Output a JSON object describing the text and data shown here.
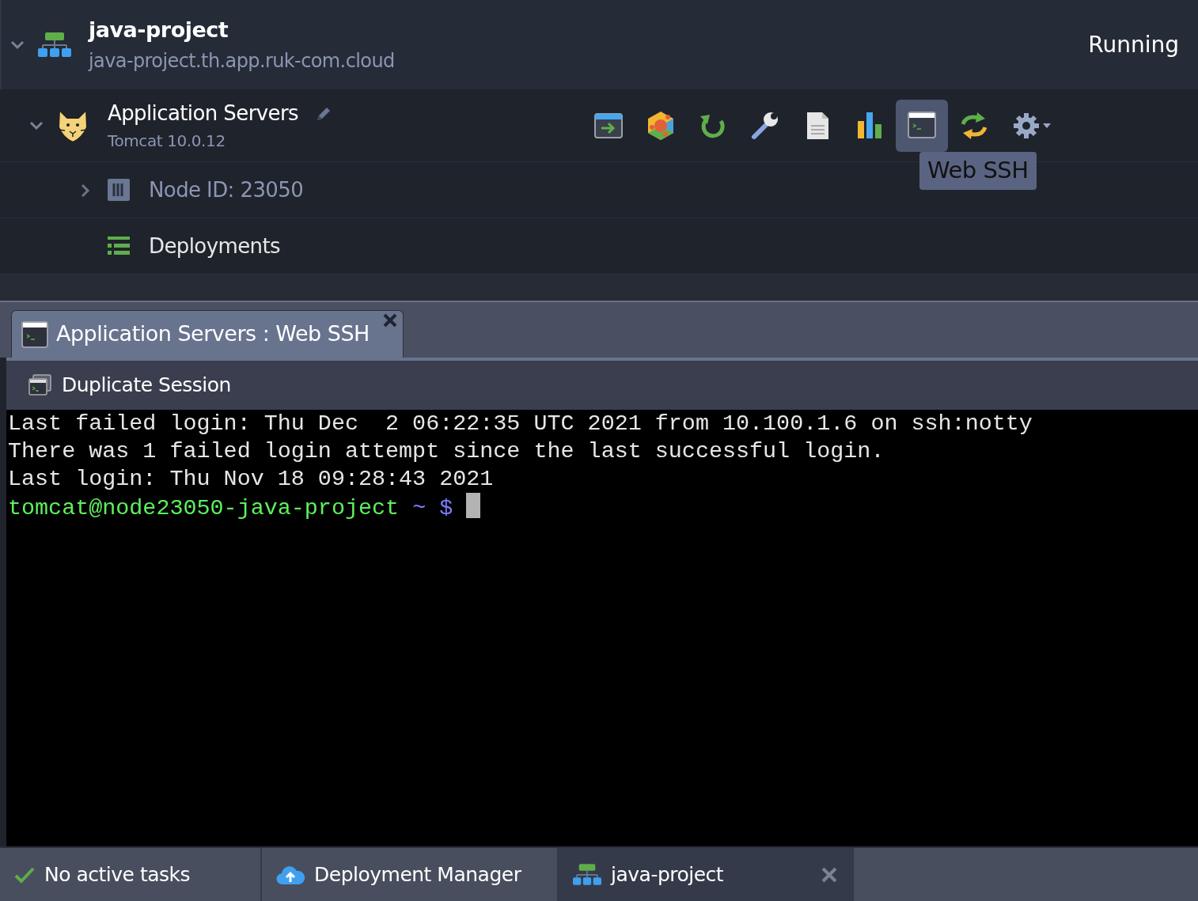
{
  "environment": {
    "name": "java-project",
    "domain": "java-project.th.app.ruk-com.cloud",
    "status": "Running",
    "expanded": true
  },
  "node_group": {
    "name": "Application Servers",
    "version": "Tomcat 10.0.12",
    "expanded": true,
    "toolbar": [
      {
        "kind": "open",
        "selected": false
      },
      {
        "kind": "addons",
        "selected": false
      },
      {
        "kind": "restart",
        "selected": false
      },
      {
        "kind": "config",
        "selected": false
      },
      {
        "kind": "log",
        "selected": false
      },
      {
        "kind": "stats",
        "selected": false
      },
      {
        "kind": "ssh",
        "selected": true
      },
      {
        "kind": "redeploy",
        "selected": false
      },
      {
        "kind": "settings",
        "selected": false
      }
    ],
    "tooltip": "Web SSH",
    "children": [
      {
        "kind": "node",
        "label": "Node ID: 23050",
        "expanded": false
      },
      {
        "kind": "deployments",
        "label": "Deployments"
      }
    ]
  },
  "session_tabs": [
    {
      "label": "Application Servers : Web SSH",
      "selected": true
    }
  ],
  "session_toolbar": {
    "action": "Duplicate Session"
  },
  "terminal": {
    "lines": [
      "Last failed login: Thu Dec  2 06:22:35 UTC 2021 from 10.100.1.6 on ssh:notty",
      "There was 1 failed login attempt since the last successful login.",
      "Last login: Thu Nov 18 09:28:43 2021"
    ],
    "prompt": {
      "user": "tomcat@node23050-java-project",
      "path": "~",
      "symbol": "$"
    }
  },
  "status_bar": [
    {
      "kind": "tasks",
      "label": "No active tasks",
      "selected": false
    },
    {
      "kind": "deploy",
      "label": "Deployment Manager",
      "selected": false
    },
    {
      "kind": "env",
      "label": "java-project",
      "selected": true
    }
  ]
}
